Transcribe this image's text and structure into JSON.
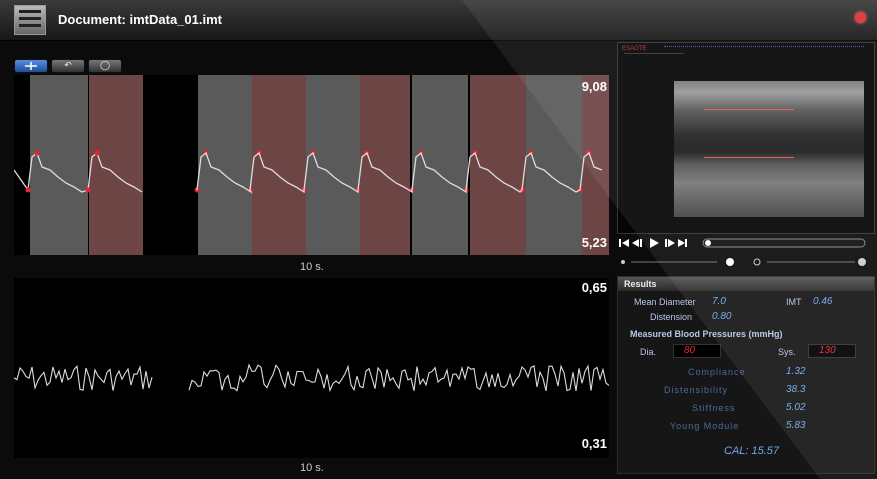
{
  "window": {
    "title": "Document: imtData_01.imt"
  },
  "toolbar": {
    "buttons": [
      {
        "name": "select"
      },
      {
        "name": "undo",
        "glyph": "↶"
      },
      {
        "name": "loop",
        "glyph": "◯"
      }
    ]
  },
  "top_panel": {
    "max_label": "9,08",
    "min_label": "5,23",
    "time_label": "10 s."
  },
  "bottom_panel": {
    "max_label": "0,65",
    "min_label": "0,31",
    "time_label": "10 s."
  },
  "video": {
    "brand_text": "ESAOTE"
  },
  "results": {
    "title": "Results",
    "mean_diameter_label": "Mean Diameter",
    "mean_diameter_value": "7.0",
    "imt_label": "IMT",
    "imt_value": "0.46",
    "distension_label": "Distension",
    "distension_value": "0.80",
    "bp_header": "Measured Blood Pressures (mmHg)",
    "dia_label": "Dia.",
    "dia_value": "80",
    "sys_label": "Sys.",
    "sys_value": "130",
    "metrics": [
      {
        "label": "Compliance",
        "value": "1.32"
      },
      {
        "label": "Distensibility",
        "value": "38.3"
      },
      {
        "label": "Stiffness",
        "value": "5.02"
      },
      {
        "label": "Young Module",
        "value": "5.83"
      }
    ],
    "cal_text": "CAL: 15.57"
  },
  "colors": {
    "accent_red": "#e23",
    "metric_blue": "#6fa8e8",
    "segment_gray": "#5a5a5a",
    "segment_red": "#6e4545"
  }
}
